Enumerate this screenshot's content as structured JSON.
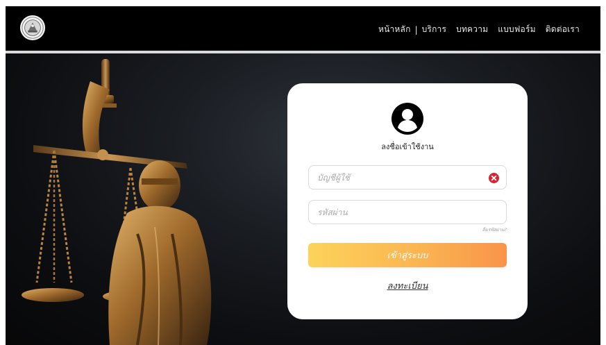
{
  "nav": {
    "items": [
      "หน้าหลัก",
      "บริการ",
      "บทความ",
      "แบบฟอร์ม",
      "ติดต่อเรา"
    ],
    "separator": "|"
  },
  "login": {
    "title": "ลงชื่อเข้าใช้งาน",
    "username_placeholder": "บัญชีผู้ใช้",
    "password_placeholder": "รหัสผ่าน",
    "forgot": "ลืมรหัสผ่าน?",
    "submit": "เข้าสู่ระบบ",
    "register": "ลงทะเบียน"
  },
  "colors": {
    "topbar": "#000000",
    "button_start": "#fcd35a",
    "button_end": "#f9944a",
    "clear_icon": "#d9232e"
  },
  "icons": {
    "logo": "emblem-seal",
    "user": "user-circle-icon",
    "clear": "clear-x-icon"
  }
}
